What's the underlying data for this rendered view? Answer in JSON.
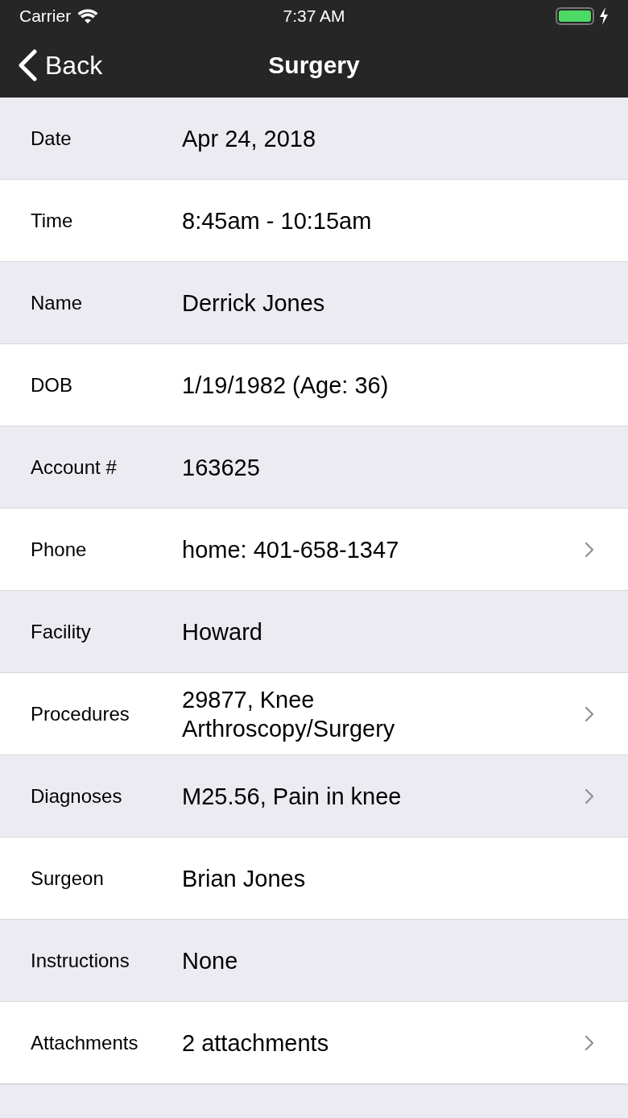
{
  "status_bar": {
    "carrier": "Carrier",
    "time": "7:37 AM",
    "charging": true
  },
  "nav_bar": {
    "back": "Back",
    "title": "Surgery"
  },
  "rows": [
    {
      "label": "Date",
      "value": "Apr 24, 2018",
      "disclosure": false
    },
    {
      "label": "Time",
      "value": "8:45am - 10:15am",
      "disclosure": false
    },
    {
      "label": "Name",
      "value": "Derrick Jones",
      "disclosure": false
    },
    {
      "label": "DOB",
      "value": "1/19/1982 (Age: 36)",
      "disclosure": false
    },
    {
      "label": "Account #",
      "value": "163625",
      "disclosure": false
    },
    {
      "label": "Phone",
      "value": "home: 401-658-1347",
      "disclosure": true
    },
    {
      "label": "Facility",
      "value": "Howard",
      "disclosure": false
    },
    {
      "label": "Procedures",
      "value": "29877, Knee Arthroscopy/Surgery",
      "disclosure": true
    },
    {
      "label": "Diagnoses",
      "value": "M25.56, Pain in knee",
      "disclosure": true
    },
    {
      "label": "Surgeon",
      "value": "Brian Jones",
      "disclosure": false
    },
    {
      "label": "Instructions",
      "value": "None",
      "disclosure": false
    },
    {
      "label": "Attachments",
      "value": "2 attachments",
      "disclosure": true
    }
  ]
}
